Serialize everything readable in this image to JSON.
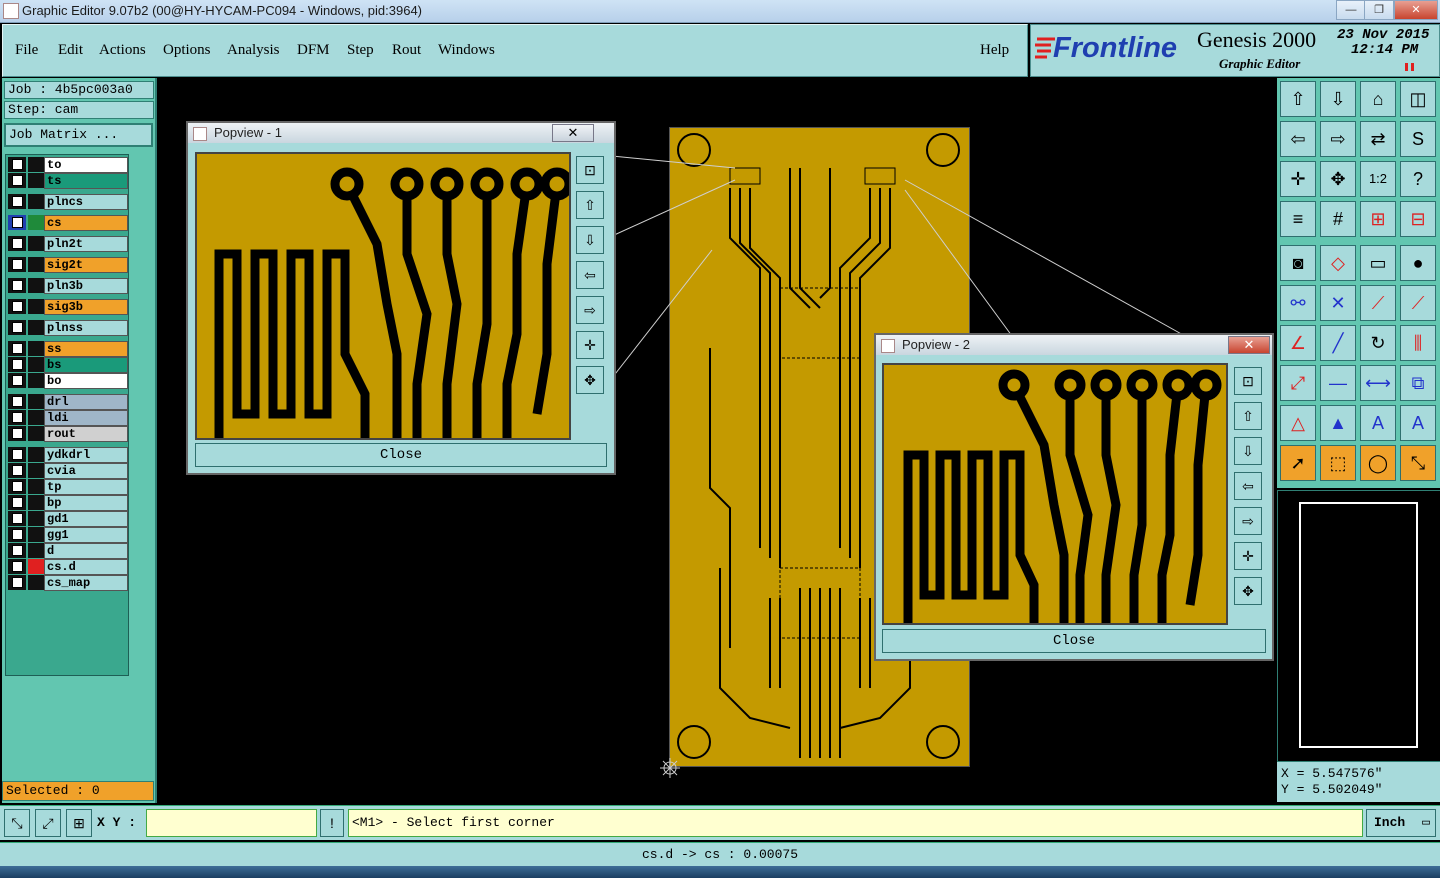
{
  "window": {
    "title": "Graphic Editor 9.07b2 (00@HY-HYCAM-PC094 - Windows, pid:3964)",
    "controls": [
      "—",
      "❐",
      "✕"
    ]
  },
  "menubar": {
    "items": [
      "File",
      "Edit",
      "Actions",
      "Options",
      "Analysis",
      "DFM",
      "Step",
      "Rout",
      "Windows"
    ],
    "help": "Help"
  },
  "branding": {
    "logo": "Frontline",
    "product": "Genesis 2000",
    "subtitle": "Graphic Editor",
    "date": "23 Nov 2015",
    "time": "12:14 PM"
  },
  "job": {
    "job_label": "Job : 4b5pc003a0",
    "step_label": "Step: cam",
    "matrix_button": "Job Matrix ..."
  },
  "layers": [
    {
      "name": "to",
      "color": "#ffffff",
      "swatch": "#111111"
    },
    {
      "name": "ts",
      "color": "#1a9a7a",
      "swatch": "#111111"
    },
    {
      "name": "plncs",
      "color": "#a7dadb",
      "swatch": "#111111"
    },
    {
      "name": "cs",
      "color": "#f0a12a",
      "swatch": "#1f8a3a",
      "active": true
    },
    {
      "name": "pln2t",
      "color": "#a7dadb",
      "swatch": "#111111"
    },
    {
      "name": "sig2t",
      "color": "#f0a12a",
      "swatch": "#111111"
    },
    {
      "name": "pln3b",
      "color": "#a7dadb",
      "swatch": "#111111"
    },
    {
      "name": "sig3b",
      "color": "#f0a12a",
      "swatch": "#111111"
    },
    {
      "name": "plnss",
      "color": "#a7dadb",
      "swatch": "#111111"
    },
    {
      "name": "ss",
      "color": "#f0a12a",
      "swatch": "#111111"
    },
    {
      "name": "bs",
      "color": "#1a9a7a",
      "swatch": "#111111"
    },
    {
      "name": "bo",
      "color": "#ffffff",
      "swatch": "#111111"
    },
    {
      "name": "drl",
      "color": "#9fb6c8",
      "swatch": "#111111"
    },
    {
      "name": "ldi",
      "color": "#9fb6c8",
      "swatch": "#111111"
    },
    {
      "name": "rout",
      "color": "#d0d0d0",
      "swatch": "#111111"
    },
    {
      "name": "ydkdrl",
      "color": "#a7dadb",
      "swatch": "#111111"
    },
    {
      "name": "cvia",
      "color": "#a7dadb",
      "swatch": "#111111"
    },
    {
      "name": "tp",
      "color": "#a7dadb",
      "swatch": "#111111"
    },
    {
      "name": "bp",
      "color": "#a7dadb",
      "swatch": "#111111"
    },
    {
      "name": "gd1",
      "color": "#a7dadb",
      "swatch": "#111111"
    },
    {
      "name": "gg1",
      "color": "#a7dadb",
      "swatch": "#111111"
    },
    {
      "name": "d",
      "color": "#a7dadb",
      "swatch": "#111111"
    },
    {
      "name": "cs.d",
      "color": "#a7dadb",
      "swatch": "#e02020"
    },
    {
      "name": "cs_map",
      "color": "#a7dadb",
      "swatch": "#111111"
    }
  ],
  "selected": "Selected : 0",
  "popup1": {
    "title": "Popview - 1",
    "close_x": "✕",
    "close_label": "Close"
  },
  "popup2": {
    "title": "Popview - 2",
    "close_x": "✕",
    "close_label": "Close"
  },
  "coords": {
    "x": "X = 5.547576\"",
    "y": "Y = 5.502049\""
  },
  "command": {
    "xy_label": "X Y :",
    "xy_value": "",
    "prompt": "<M1> - Select first corner",
    "units": "Inch"
  },
  "status": "cs.d -> cs : 0.00075",
  "colors": {
    "panel": "#a7dadb",
    "panel_dark": "#62c6b0",
    "copper": "#c49a00",
    "highlight": "#f0a12a"
  }
}
